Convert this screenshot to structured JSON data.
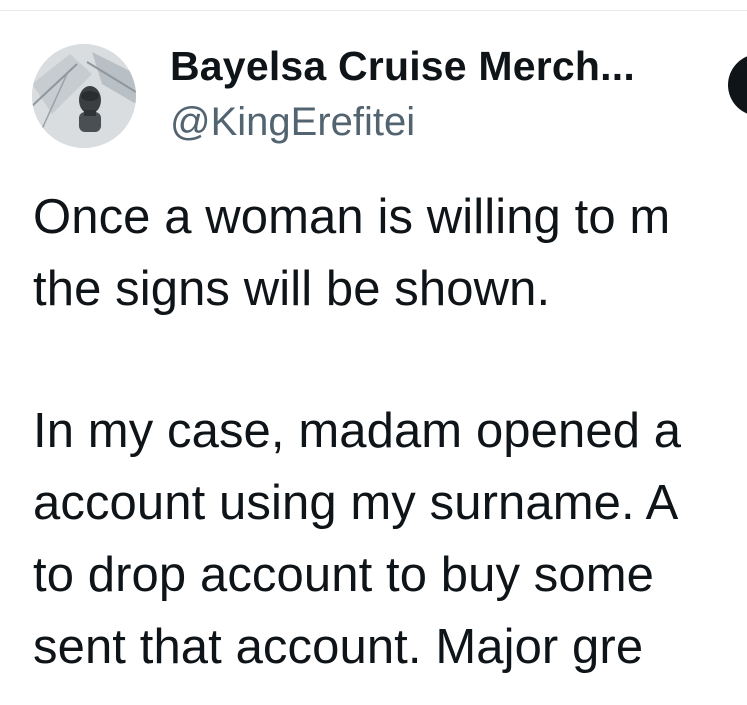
{
  "author": {
    "display_name": "Bayelsa Cruise Merch...",
    "handle": "@KingErefitei"
  },
  "post": {
    "paragraph_1": [
      "Once a woman is willing to m",
      "the signs will be shown."
    ],
    "paragraph_2": [
      "In my case, madam opened a",
      "account using my surname. A",
      "to drop account to buy some",
      "sent that account. Major gre"
    ]
  },
  "icons": {
    "avatar": "profile-photo",
    "follow": "follow-button"
  },
  "colors": {
    "text": "#0f1419",
    "secondary": "#536471",
    "button": "#0f1419",
    "background": "#ffffff"
  }
}
